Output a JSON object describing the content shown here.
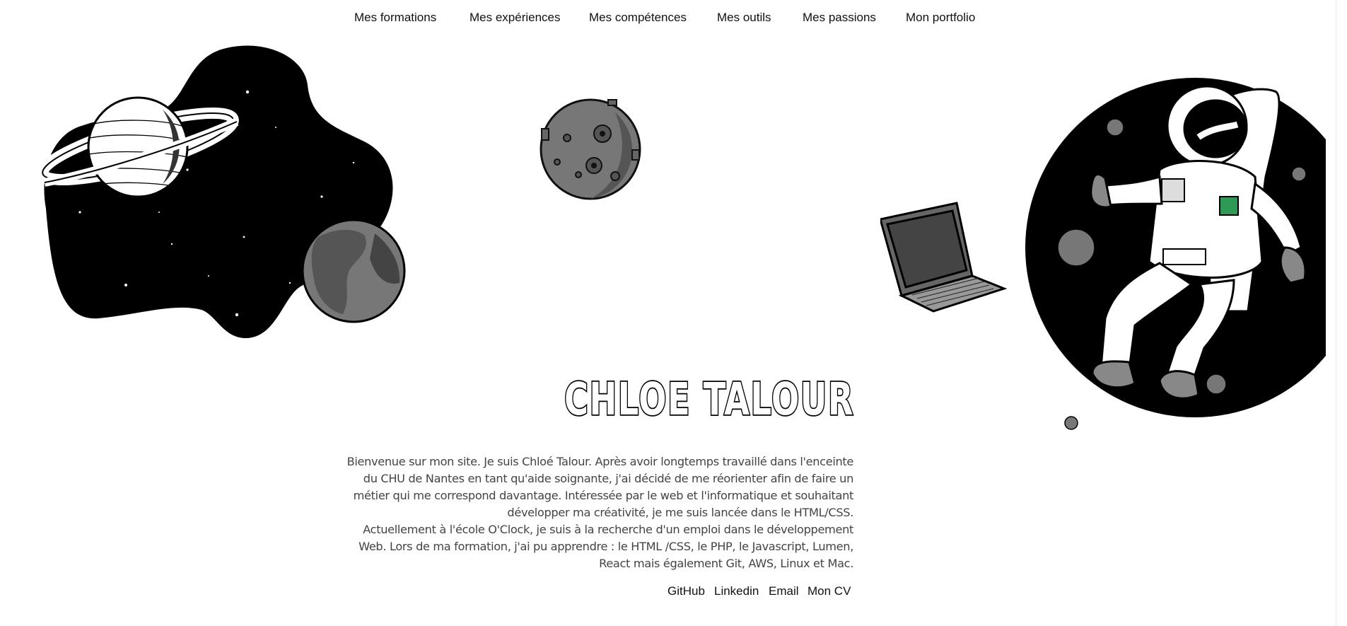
{
  "nav": {
    "items": [
      {
        "label": "Mes formations"
      },
      {
        "label": "Mes expériences"
      },
      {
        "label": "Mes compétences"
      },
      {
        "label": "Mes outils"
      },
      {
        "label": "Mes passions"
      },
      {
        "label": "Mon portfolio"
      }
    ]
  },
  "hero": {
    "title": "CHLOE TALOUR",
    "paragraph_1": "Bienvenue sur mon site. Je suis Chloé Talour. Après avoir longtemps travaillé dans l'enceinte du CHU de Nantes en tant qu'aide soignante, j'ai décidé de me réorienter afin de faire un métier qui me correspond davantage. Intéressée par le web et l'informatique et souhaitant développer ma créativité, je me suis lancée dans le HTML/CSS.",
    "paragraph_2": "Actuellement à l'école O'Clock, je suis à la recherche d'un emploi dans le développement Web. Lors de ma formation, j'ai pu apprendre : le HTML /CSS, le PHP, le Javascript, Lumen, React mais également Git, AWS, Linux et Mac."
  },
  "links": {
    "github": "GitHub",
    "linkedin": "Linkedin",
    "email": "Email",
    "cv": "Mon CV"
  },
  "icons": {
    "space_scene": "saturn-and-earth-illustration",
    "moon": "moon-illustration",
    "astronaut": "astronaut-with-laptop-illustration"
  },
  "colors": {
    "background": "#ffffff",
    "text": "#111111",
    "body_text": "#444444",
    "illustration_dark": "#000000",
    "illustration_grey": "#7a7a7a",
    "badge_green": "#2e9a55"
  }
}
